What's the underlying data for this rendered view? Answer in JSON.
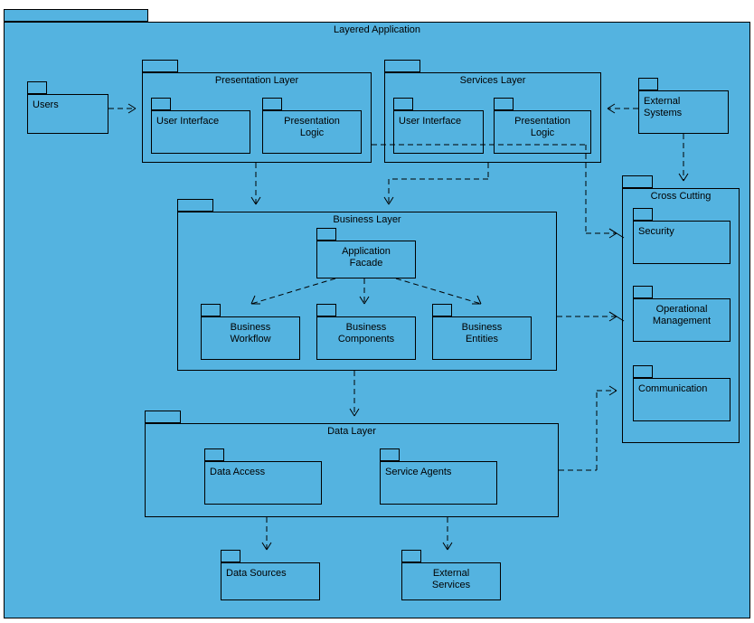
{
  "diagram": {
    "title": "Layered Application",
    "packages": {
      "users": {
        "label": "Users"
      },
      "presentation_layer": {
        "label": "Presentation Layer"
      },
      "pl_ui": {
        "label": "User Interface"
      },
      "pl_logic": {
        "label": "Presentation\nLogic"
      },
      "services_layer": {
        "label": "Services Layer"
      },
      "sl_ui": {
        "label": "User Interface"
      },
      "sl_logic": {
        "label": "Presentation\nLogic"
      },
      "external_systems": {
        "label": "External\nSystems"
      },
      "business_layer": {
        "label": "Business Layer"
      },
      "bl_facade": {
        "label": "Application\nFacade"
      },
      "bl_workflow": {
        "label": "Business\nWorkflow"
      },
      "bl_components": {
        "label": "Business\nComponents"
      },
      "bl_entities": {
        "label": "Business\nEntities"
      },
      "data_layer": {
        "label": "Data Layer"
      },
      "dl_access": {
        "label": "Data Access"
      },
      "dl_agents": {
        "label": "Service Agents"
      },
      "data_sources": {
        "label": "Data Sources"
      },
      "external_services": {
        "label": "External\nServices"
      },
      "cross_cutting": {
        "label": "Cross Cutting"
      },
      "cc_security": {
        "label": "Security"
      },
      "cc_opmgmt": {
        "label": "Operational\nManagement"
      },
      "cc_comm": {
        "label": "Communication"
      }
    }
  }
}
